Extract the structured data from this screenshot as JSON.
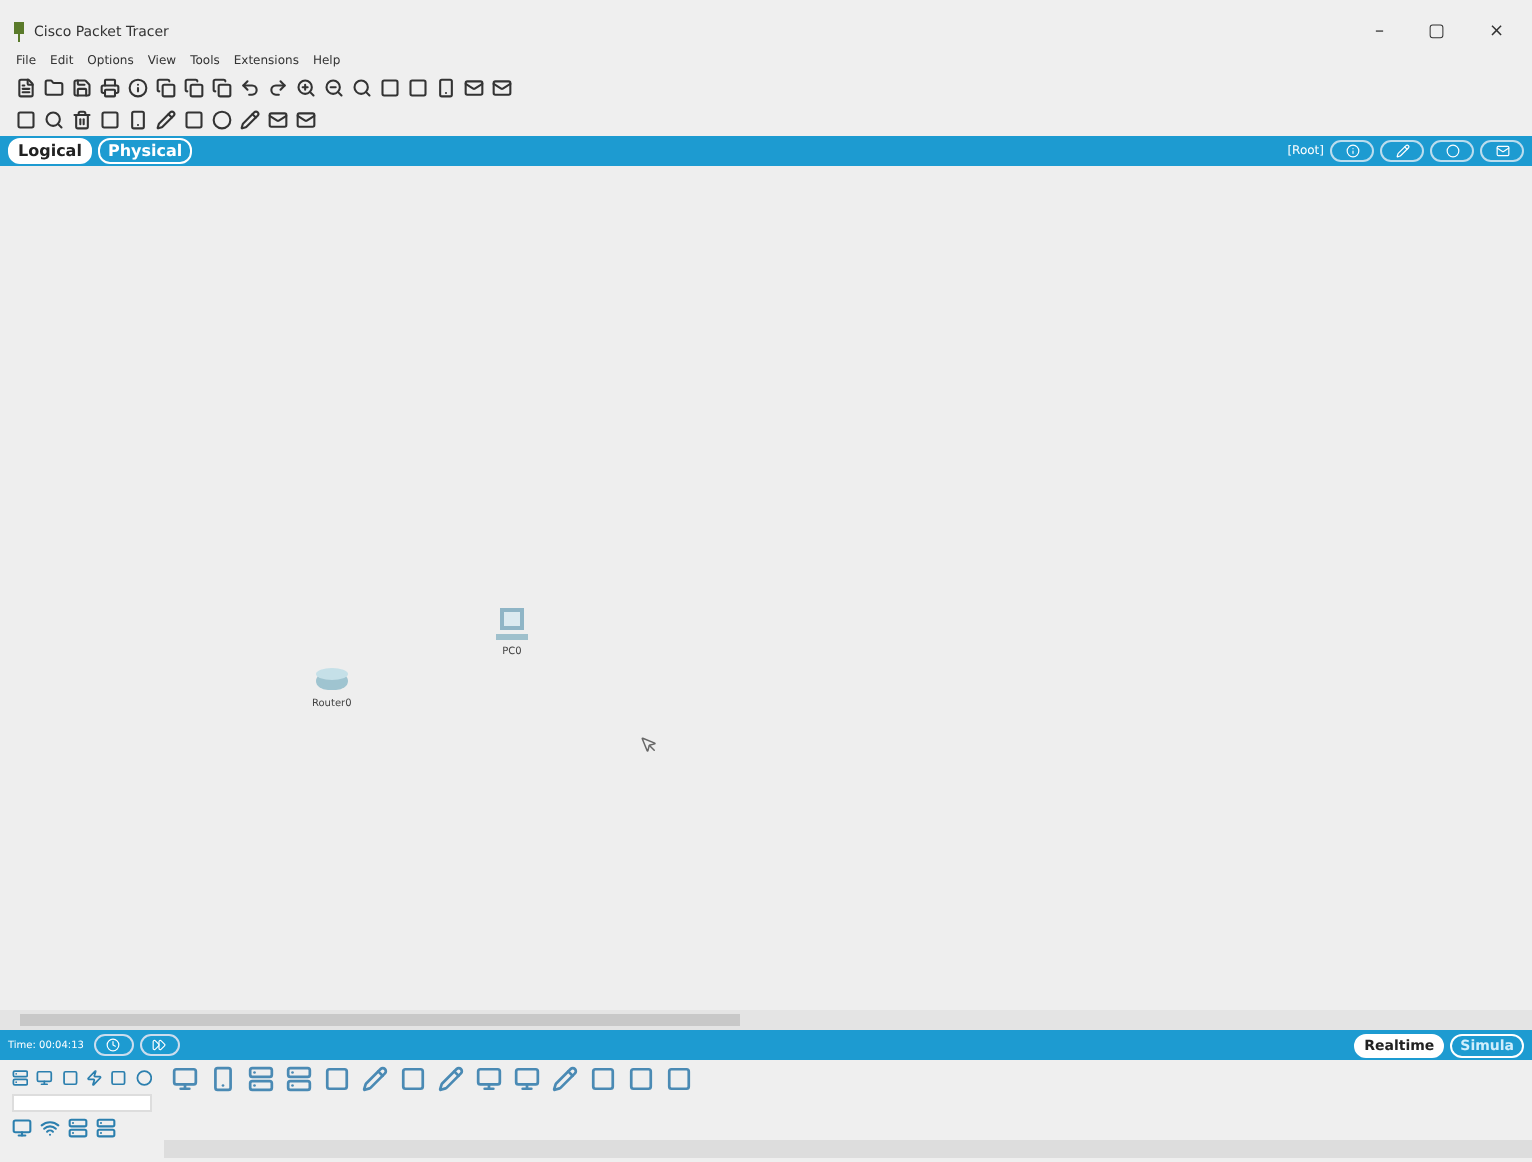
{
  "window": {
    "title": "Cisco Packet Tracer",
    "controls": [
      "–",
      "▢",
      "×"
    ]
  },
  "menu": [
    "File",
    "Edit",
    "Options",
    "View",
    "Tools",
    "Extensions",
    "Help"
  ],
  "view_tabs": [
    {
      "label": "Logical",
      "selected": true
    },
    {
      "label": "Physical",
      "selected": false
    }
  ],
  "workspace_path": "[Root]",
  "canvas": {
    "nodes": [
      {
        "kind": "router",
        "label": "Router0"
      },
      {
        "kind": "pc",
        "label": "PC0"
      }
    ]
  },
  "time_bar": {
    "time": "Time: 00:04:13"
  },
  "mode_tabs": [
    {
      "label": "Realtime",
      "selected": true
    },
    {
      "label": "Simula",
      "selected": false
    }
  ]
}
